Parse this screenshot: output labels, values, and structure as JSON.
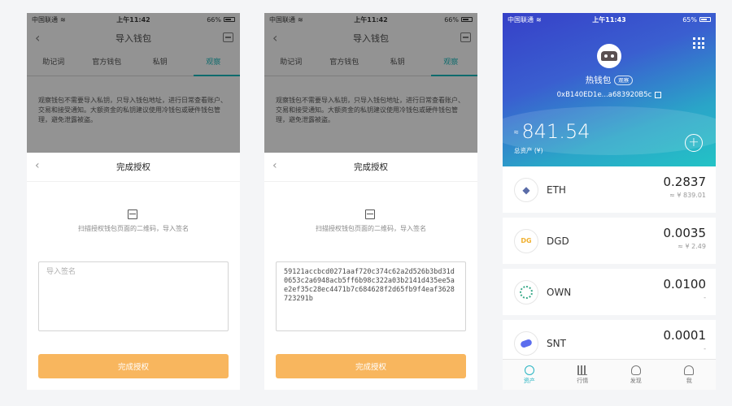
{
  "status": {
    "carrier": "中国联通",
    "time_a": "上午11:42",
    "time_b": "上午11:43",
    "battery_a": "66%",
    "battery_b": "65%"
  },
  "import": {
    "title": "导入钱包",
    "tabs": [
      "助记词",
      "官方钱包",
      "私钥",
      "观察"
    ],
    "active_tab": "观察",
    "note": "观察钱包不需要导入私钥，只导入钱包地址，进行日常查看账户、交易和接受通知。大额资金的私钥建议使用冷钱包或硬件钱包管理，避免泄露被盗。"
  },
  "sheet": {
    "title": "完成授权",
    "scan_hint": "扫描授权钱包页面的二维码，导入签名",
    "placeholder": "导入签名",
    "signature": "59121accbcd0271aaf720c374c62a2d526b3bd31d0653c2a6948acb5ff6b98c322a03b2141d435ee5ae2ef35c28ec4471b7c684628f2d65fb9f4eaf3628723291b",
    "button": "完成授权"
  },
  "wallet": {
    "name": "热钱包",
    "tag": "观察",
    "address": "0xB140ED1e...a683920B5c",
    "balance_approx": "≈",
    "balance": "841.54",
    "balance_label": "总资产 (¥)",
    "add": "+"
  },
  "tokens": [
    {
      "symbol": "ETH",
      "amount": "0.2837",
      "fiat": "≈ ¥ 839.01"
    },
    {
      "symbol": "DGD",
      "amount": "0.0035",
      "fiat": "≈ ¥ 2.49"
    },
    {
      "symbol": "OWN",
      "amount": "0.0100",
      "fiat": "-"
    },
    {
      "symbol": "SNT",
      "amount": "0.0001",
      "fiat": "-"
    }
  ],
  "nav": [
    {
      "label": "资产",
      "icon": "assets-icon"
    },
    {
      "label": "行情",
      "icon": "market-icon"
    },
    {
      "label": "发现",
      "icon": "discover-icon"
    },
    {
      "label": "我",
      "icon": "profile-icon"
    }
  ],
  "colors": {
    "accent": "#0e6b6d",
    "button": "#f8b65e",
    "gradient_start": "#3640c8",
    "gradient_end": "#23c3c6",
    "nav_active": "#27b4c2"
  }
}
